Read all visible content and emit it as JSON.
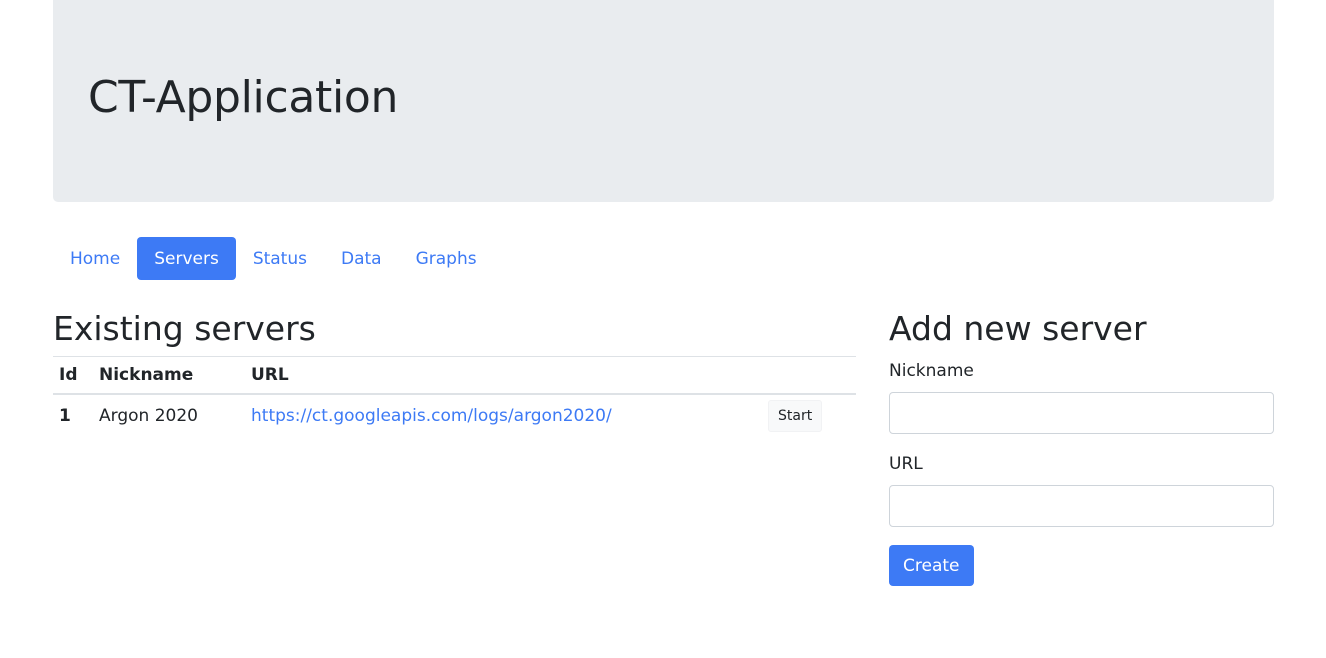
{
  "header": {
    "title": "CT-Application"
  },
  "nav": {
    "items": [
      {
        "label": "Home",
        "active": false
      },
      {
        "label": "Servers",
        "active": true
      },
      {
        "label": "Status",
        "active": false
      },
      {
        "label": "Data",
        "active": false
      },
      {
        "label": "Graphs",
        "active": false
      }
    ]
  },
  "servers": {
    "heading": "Existing servers",
    "columns": [
      "Id",
      "Nickname",
      "URL"
    ],
    "rows": [
      {
        "id": "1",
        "nickname": "Argon 2020",
        "url": "https://ct.googleapis.com/logs/argon2020/",
        "action": "Start"
      }
    ]
  },
  "form": {
    "heading": "Add new server",
    "nickname_label": "Nickname",
    "nickname_value": "",
    "url_label": "URL",
    "url_value": "",
    "submit_label": "Create"
  },
  "colors": {
    "primary": "#3d7af5",
    "jumbotron": "#e9ecef",
    "text": "#212529"
  }
}
